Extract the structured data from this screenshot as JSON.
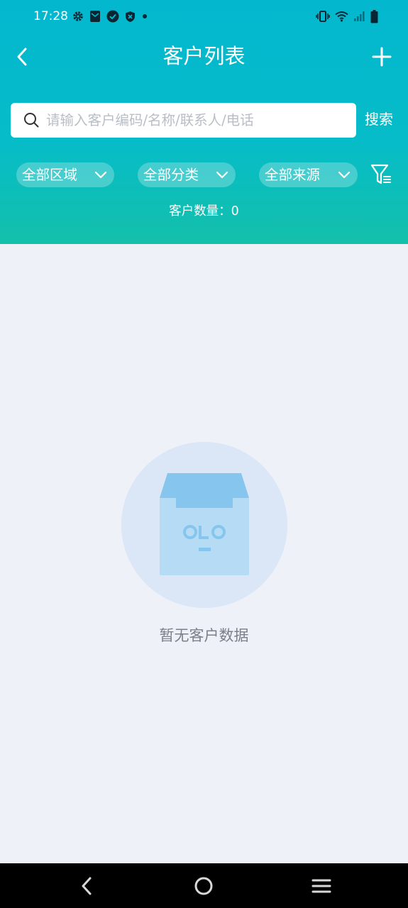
{
  "status_bar": {
    "time": "17:28",
    "left_icons": [
      "settings-icon",
      "mail-icon",
      "check-badge-icon",
      "shield-icon",
      "dot-icon"
    ],
    "right_icons": [
      "vibrate-icon",
      "wifi-icon",
      "signal-icon",
      "battery-icon"
    ]
  },
  "nav": {
    "title": "客户列表",
    "back_icon": "back-chevron-icon",
    "add_icon": "plus-icon"
  },
  "search": {
    "placeholder": "请输入客户编码/名称/联系人/电话",
    "value": "",
    "button_label": "搜索"
  },
  "filters": {
    "area_label": "全部区域",
    "category_label": "全部分类",
    "source_label": "全部来源",
    "filter_icon": "filter-icon"
  },
  "count": {
    "text": "客户数量：0"
  },
  "empty_state": {
    "text": "暂无客户数据",
    "illustration": "empty-box-icon"
  },
  "colors": {
    "header_top": "#03b7cf",
    "header_bottom": "#14c0aa",
    "page_background": "#eef1f8",
    "empty_circle": "#dbe7f6",
    "box_light": "#b6dcf5",
    "box_dark": "#86c6ee",
    "system_nav": "#000000"
  },
  "system_nav": {
    "buttons": [
      "back-triangle-icon",
      "home-circle-icon",
      "menu-icon"
    ]
  }
}
